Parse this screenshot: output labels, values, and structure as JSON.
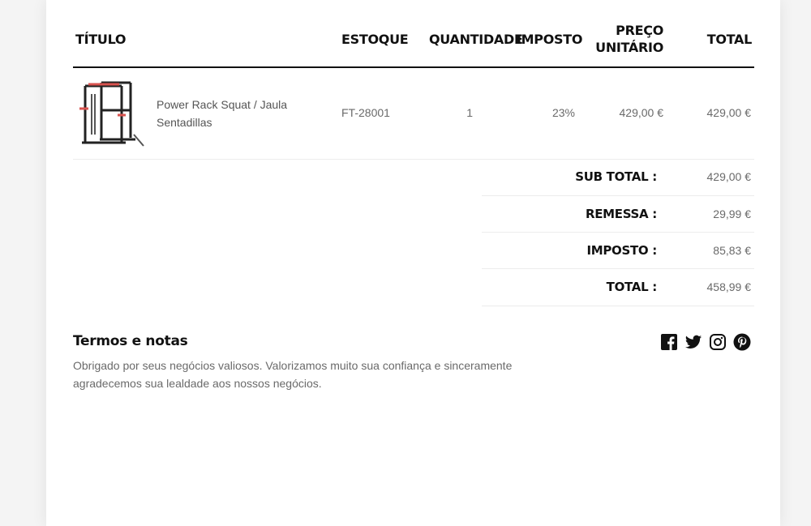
{
  "table": {
    "headers": {
      "title": "TÍTULO",
      "stock": "ESTOQUE",
      "quantity": "QUANTIDADE",
      "tax": "IMPOSTO",
      "unit_price_line1": "PREÇO",
      "unit_price_line2": "UNITÁRIO",
      "total": "TOTAL"
    },
    "rows": [
      {
        "image_icon": "power-rack-image",
        "name_line1": "Power Rack Squat / Jaula",
        "name_line2": "Sentadillas",
        "sku": "FT-28001",
        "quantity": "1",
        "tax": "23%",
        "unit_price": "429,00 €",
        "total": "429,00 €"
      }
    ]
  },
  "summary": {
    "subtotal_label": "SUB TOTAL :",
    "subtotal_value": "429,00 €",
    "shipping_label": "REMESSA :",
    "shipping_value": "29,99 €",
    "tax_label": "IMPOSTO :",
    "tax_value": "85,83 €",
    "total_label": "TOTAL :",
    "total_value": "458,99 €"
  },
  "notes": {
    "heading": "Termos e notas",
    "line1": "Obrigado por seus negócios valiosos. Valorizamos muito sua confiança e sinceramente",
    "line2": "agradecemos sua lealdade aos nossos negócios."
  },
  "social_icons": [
    "facebook-icon",
    "twitter-icon",
    "instagram-icon",
    "pinterest-icon"
  ],
  "colors": {
    "text_dark": "#111111",
    "text_muted": "#6a6a6a",
    "rack_accent": "#d9534f"
  }
}
